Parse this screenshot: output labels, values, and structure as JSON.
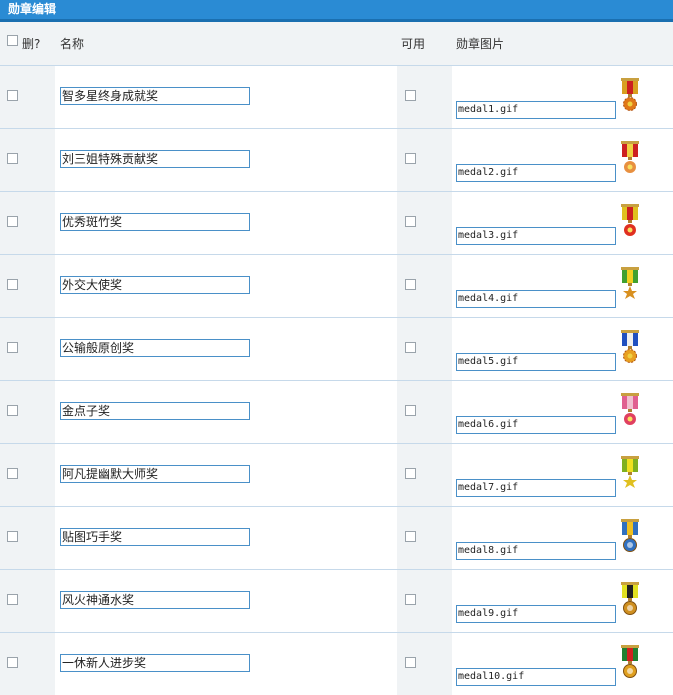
{
  "title": "勋章编辑",
  "header": {
    "delete": "删?",
    "name": "名称",
    "enabled": "可用",
    "image": "勋章图片"
  },
  "medals": [
    {
      "name": "智多星终身成就奖",
      "file": "medal1.gif",
      "ribbon": [
        "#d8a020",
        "#cc2020",
        "#d8a020"
      ],
      "medal": "#e07818",
      "shape": "sun"
    },
    {
      "name": "刘三姐特殊贡献奖",
      "file": "medal2.gif",
      "ribbon": [
        "#cc2020",
        "#f0d040",
        "#cc2020"
      ],
      "medal": "#e89040",
      "shape": "flower"
    },
    {
      "name": "优秀斑竹奖",
      "file": "medal3.gif",
      "ribbon": [
        "#e0c020",
        "#cc2020",
        "#e0c020"
      ],
      "medal": "#e03020",
      "shape": "flower"
    },
    {
      "name": "外交大使奖",
      "file": "medal4.gif",
      "ribbon": [
        "#40a030",
        "#f0d020",
        "#40a030"
      ],
      "medal": "#d89020",
      "shape": "star"
    },
    {
      "name": "公输般原创奖",
      "file": "medal5.gif",
      "ribbon": [
        "#2050c0",
        "#f0f0f0",
        "#2050c0"
      ],
      "medal": "#e8a020",
      "shape": "sun"
    },
    {
      "name": "金点子奖",
      "file": "medal6.gif",
      "ribbon": [
        "#e06090",
        "#f0c0d0",
        "#e06090"
      ],
      "medal": "#e04060",
      "shape": "flower"
    },
    {
      "name": "阿凡提幽默大师奖",
      "file": "medal7.gif",
      "ribbon": [
        "#80b020",
        "#f0e020",
        "#80b020"
      ],
      "medal": "#e0c020",
      "shape": "star"
    },
    {
      "name": "贴图巧手奖",
      "file": "medal8.gif",
      "ribbon": [
        "#3070c0",
        "#f0c020",
        "#3070c0"
      ],
      "medal": "#3070c0",
      "shape": "circle"
    },
    {
      "name": "风火神通水奖",
      "file": "medal9.gif",
      "ribbon": [
        "#e0e020",
        "#202020",
        "#e0e020"
      ],
      "medal": "#d09020",
      "shape": "circle"
    },
    {
      "name": "一休新人进步奖",
      "file": "medal10.gif",
      "ribbon": [
        "#208030",
        "#d02020",
        "#208030"
      ],
      "medal": "#e0a020",
      "shape": "circle"
    }
  ]
}
